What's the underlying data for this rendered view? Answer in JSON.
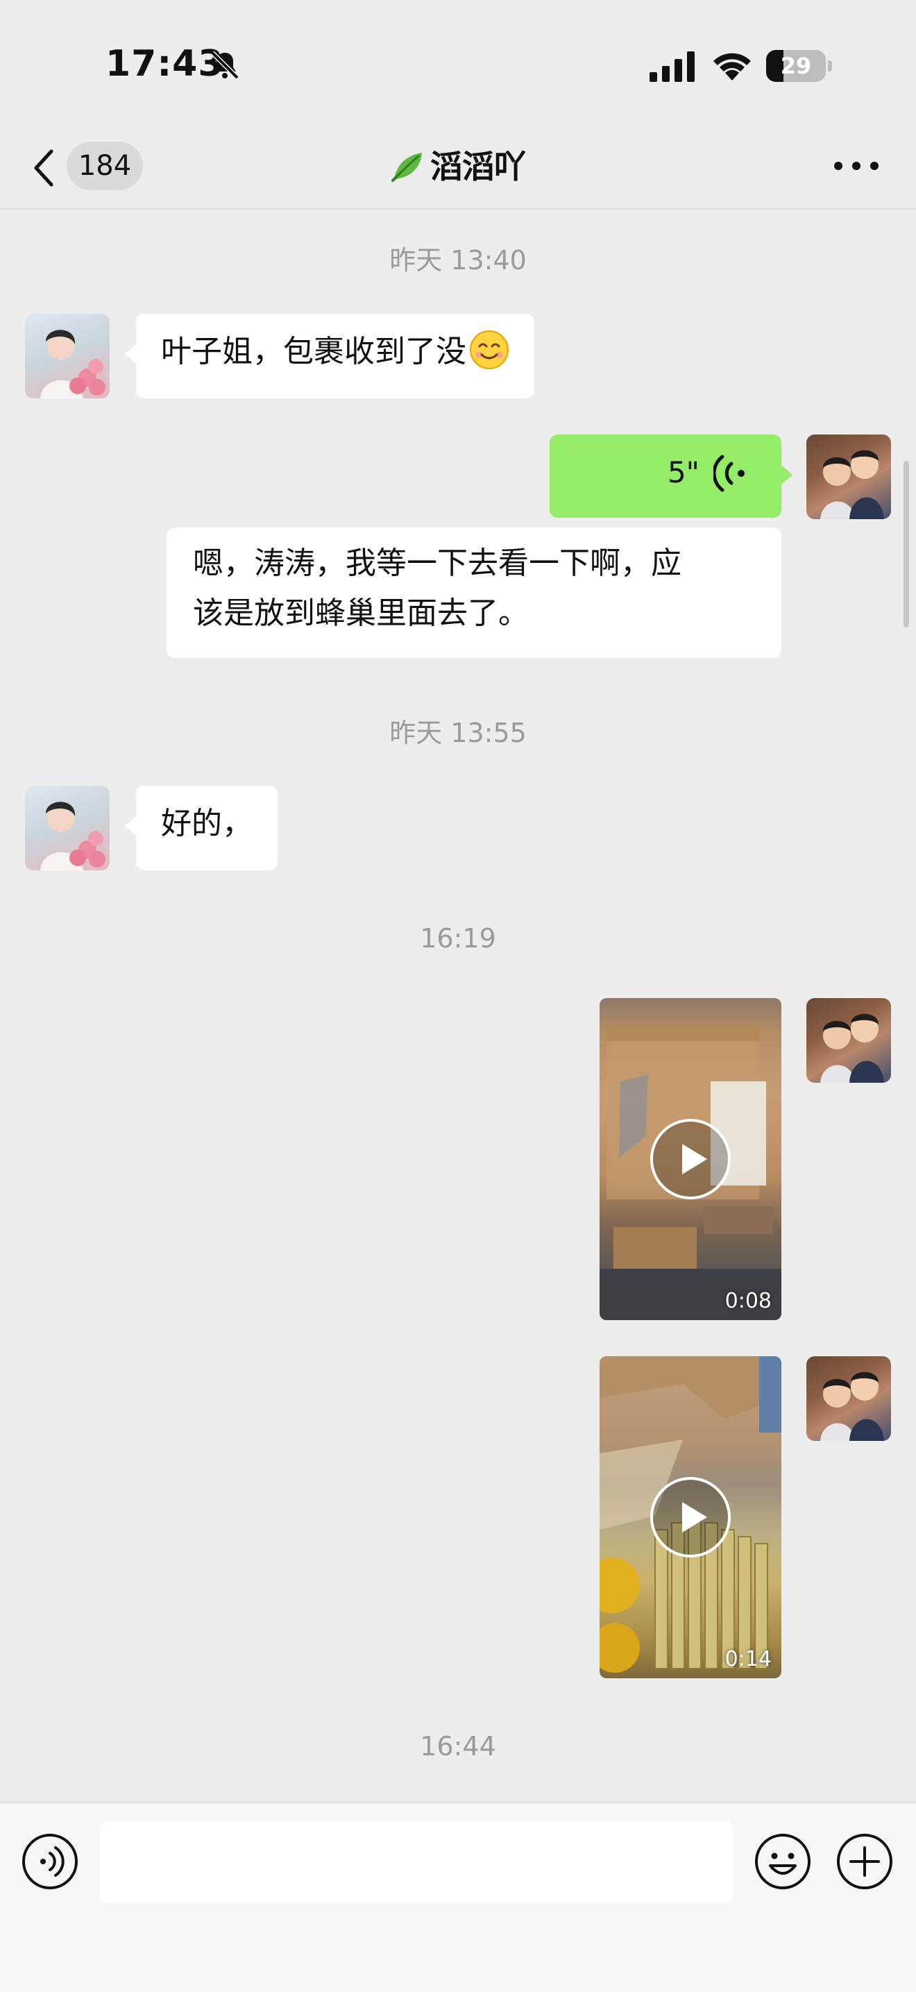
{
  "status_bar": {
    "time": "17:43",
    "battery": "29",
    "battery_level": 0.29,
    "icons": [
      "bell-slash-icon",
      "cellular-signal-icon",
      "wifi-icon",
      "battery-icon"
    ]
  },
  "nav": {
    "unread_count": "184",
    "title": "滔滔吖",
    "title_icon": "leaf-icon",
    "back_icon": "chevron-left-icon",
    "more_icon": "more-dots-icon"
  },
  "chat": {
    "bubble_out_color": "#95ec69",
    "bubble_in_color": "#ffffff",
    "timestamps": [
      "昨天 13:40",
      "昨天 13:55",
      "16:19",
      "16:44"
    ],
    "messages": [
      {
        "sender": "contact",
        "type": "text",
        "text": "叶子姐，包裹收到了没",
        "emoji": "smiling-face-emoji"
      },
      {
        "sender": "me",
        "type": "voice",
        "duration": "5\""
      },
      {
        "sender": "me",
        "type": "transcription",
        "lines": [
          "嗯，涛涛，我等一下去看一下啊，应",
          "该是放到蜂巢里面去了。"
        ]
      },
      {
        "sender": "contact",
        "type": "text",
        "text": "好的，"
      },
      {
        "sender": "me",
        "type": "video",
        "duration": "0:08"
      },
      {
        "sender": "me",
        "type": "video",
        "duration": "0:14"
      }
    ]
  },
  "input_bar": {
    "text_value": "",
    "icons": [
      "voice-input-icon",
      "emoji-icon",
      "plus-icon"
    ]
  }
}
